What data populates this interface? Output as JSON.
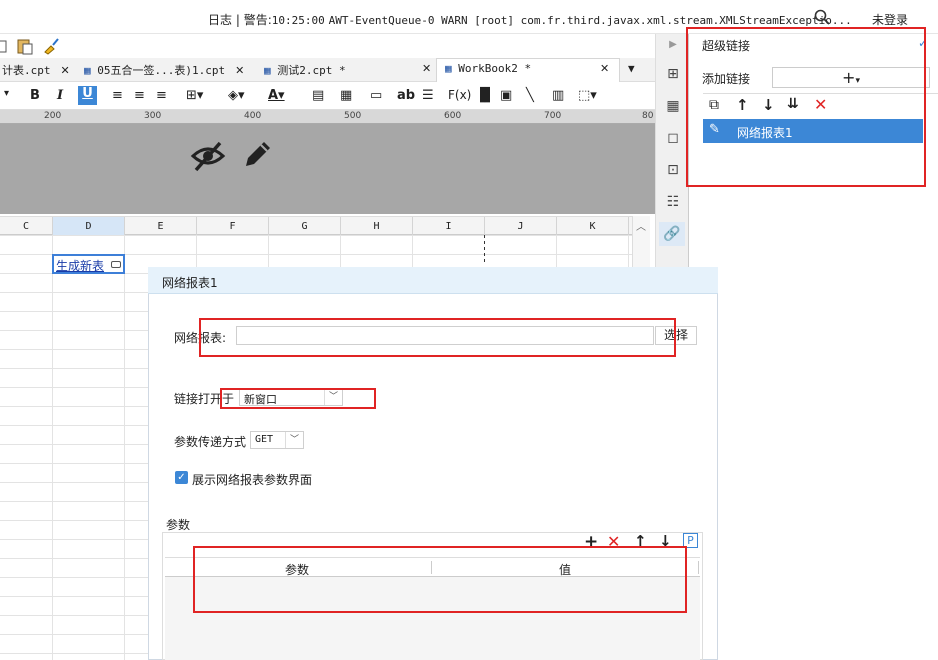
{
  "topbar": {
    "log_label": "日志",
    "separator": "|",
    "warning_prefix": "警告:",
    "warning_time": "10:25:00",
    "warning_text": "AWT-EventQueue-0 WARN [root] com.fr.third.javax.xml.stream.XMLStreamExceptio...",
    "login": "未登录"
  },
  "tabs": [
    {
      "label": "计表.cpt"
    },
    {
      "label": "05五合一签...表)1.cpt"
    },
    {
      "label": "测试2.cpt *"
    },
    {
      "label": "WorkBook2 *"
    }
  ],
  "format_toolbar": {
    "bold": "B",
    "italic": "I",
    "underline": "U",
    "ab": "ab",
    "fx": "F(x)"
  },
  "ruler": [
    "200",
    "300",
    "400",
    "500",
    "600",
    "700",
    "80"
  ],
  "columns": [
    "C",
    "D",
    "E",
    "F",
    "G",
    "H",
    "I",
    "J",
    "K"
  ],
  "cell_d2": "生成新表",
  "panel": {
    "title": "超级链接",
    "add_link_label": "添加链接",
    "add_button": "+",
    "add_caret": "▾",
    "selected_item": "网络报表1"
  },
  "dialog": {
    "title": "网络报表1",
    "url_label": "网络报表:",
    "url_value": "",
    "choose_button": "选择",
    "open_in_label": "链接打开于",
    "open_in_value": "新窗口",
    "method_label": "参数传递方式",
    "method_value": "GET",
    "show_params_label": "展示网络报表参数界面",
    "show_params_checked": true,
    "params_label": "参数",
    "param_col": "参数",
    "value_col": "值",
    "p_icon": "P"
  },
  "colors": {
    "accent": "#3c87d6",
    "highlight_red": "#e02424",
    "dialog_header": "#e6f2fb"
  }
}
